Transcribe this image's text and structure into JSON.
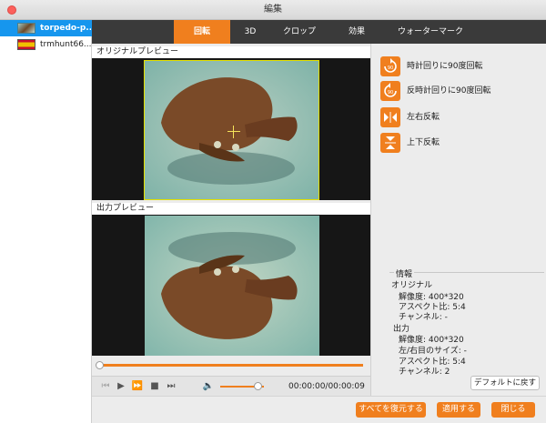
{
  "window": {
    "title": "編集"
  },
  "sidebar": {
    "files": [
      {
        "name": "torpedo-p...",
        "selected": true
      },
      {
        "name": "trmhunt66...",
        "selected": false
      }
    ]
  },
  "tabs": [
    "回転",
    "3D",
    "クロップ",
    "効果",
    "ウォーターマーク"
  ],
  "preview": {
    "original_label": "オリジナルプレビュー",
    "output_label": "出力プレビュー"
  },
  "player": {
    "timecode": "00:00:00/00:00:09",
    "seek_progress": 0.0,
    "volume_level": 0.85
  },
  "rotate": {
    "cw": "時計回りに90度回転",
    "ccw": "反時計回りに90度回転",
    "flip_h": "左右反転",
    "flip_v": "上下反転"
  },
  "info": {
    "title": "情報",
    "original": {
      "header": "オリジナル",
      "resolution": "解像度: 400*320",
      "aspect": "アスペクト比: 5:4",
      "channel": "チャンネル: -"
    },
    "output": {
      "header": "出力",
      "resolution": "解像度: 400*320",
      "eye_size": "左/右目のサイズ: -",
      "aspect": "アスペクト比: 5:4",
      "channel": "チャンネル: 2"
    }
  },
  "buttons": {
    "reset_default": "デフォルトに戻す",
    "restore_all": "すべてを復元する",
    "apply": "適用する",
    "close": "閉じる"
  },
  "colors": {
    "accent": "#f07f1e",
    "selection": "#1696ee",
    "dark": "#3a3a3a"
  }
}
